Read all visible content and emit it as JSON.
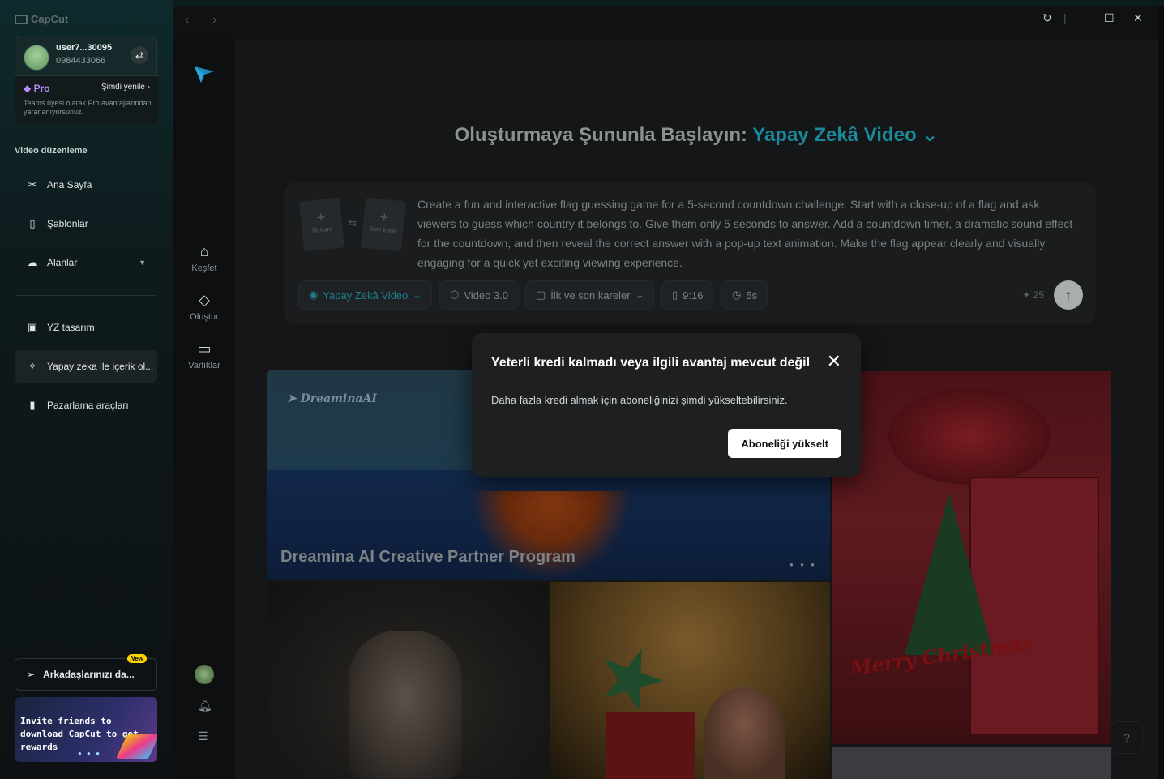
{
  "app": {
    "brand": "CapCut"
  },
  "user": {
    "name": "user7...30095",
    "phone": "0984433066",
    "pro_label": "Pro",
    "renew_label": "Şimdi yenile",
    "pro_desc": "Teams üyesi olarak Pro avantajlarından yararlanıyorsunuz."
  },
  "sidebar": {
    "section_title": "Video düzenleme",
    "items": [
      {
        "label": "Ana Sayfa",
        "icon": "scissors-icon"
      },
      {
        "label": "Şablonlar",
        "icon": "template-icon"
      },
      {
        "label": "Alanlar",
        "icon": "cloud-icon"
      },
      {
        "label": "YZ tasarım",
        "icon": "ai-design-icon"
      },
      {
        "label": "Yapay zeka ile içerik ol...",
        "icon": "sparkle-icon"
      },
      {
        "label": "Pazarlama araçları",
        "icon": "marketing-icon"
      }
    ],
    "invite_label": "Arkadaşlarınızı da...",
    "new_badge": "New",
    "banner_text": "Invite friends to download CapCut to get rewards"
  },
  "rail": {
    "items": [
      {
        "label": "Keşfet",
        "icon": "home-icon"
      },
      {
        "label": "Oluştur",
        "icon": "diamond-icon"
      },
      {
        "label": "Varlıklar",
        "icon": "folder-icon"
      }
    ]
  },
  "main": {
    "headline_prefix": "Oluşturmaya Şununla Başlayın:",
    "headline_accent": "Yapay Zekâ Video",
    "frame_first": "İlk kare",
    "frame_last": "Son kare",
    "prompt": "Create a fun and interactive flag guessing game for a 5-second countdown challenge. Start with a close-up of a flag and ask viewers to guess which country it belongs to. Give them only 5 seconds to answer. Add a countdown timer, a dramatic sound effect for the countdown, and then reveal the correct answer with a pop-up text animation. Make the flag appear clearly and visually engaging for a quick yet exciting viewing experience.",
    "chips": {
      "mode": "Yapay Zekâ Video",
      "model": "Video 3.0",
      "frames": "İlk ve son kareler",
      "ratio": "9:16",
      "duration": "5s"
    },
    "credits": "25",
    "gallery_logo": "DreaminaAI",
    "gallery_title": "Dreamina AI Creative Partner Program",
    "xmas_text": "Merry Christmas"
  },
  "modal": {
    "title": "Yeterli kredi kalmadı veya ilgili avantaj mevcut değil",
    "body": "Daha fazla kredi almak için aboneliğinizi şimdi yükseltebilirsiniz.",
    "button": "Aboneliği yükselt"
  },
  "colors": {
    "accent": "#1a8a9a",
    "pro": "#b98cff",
    "badge": "#ffd400"
  }
}
